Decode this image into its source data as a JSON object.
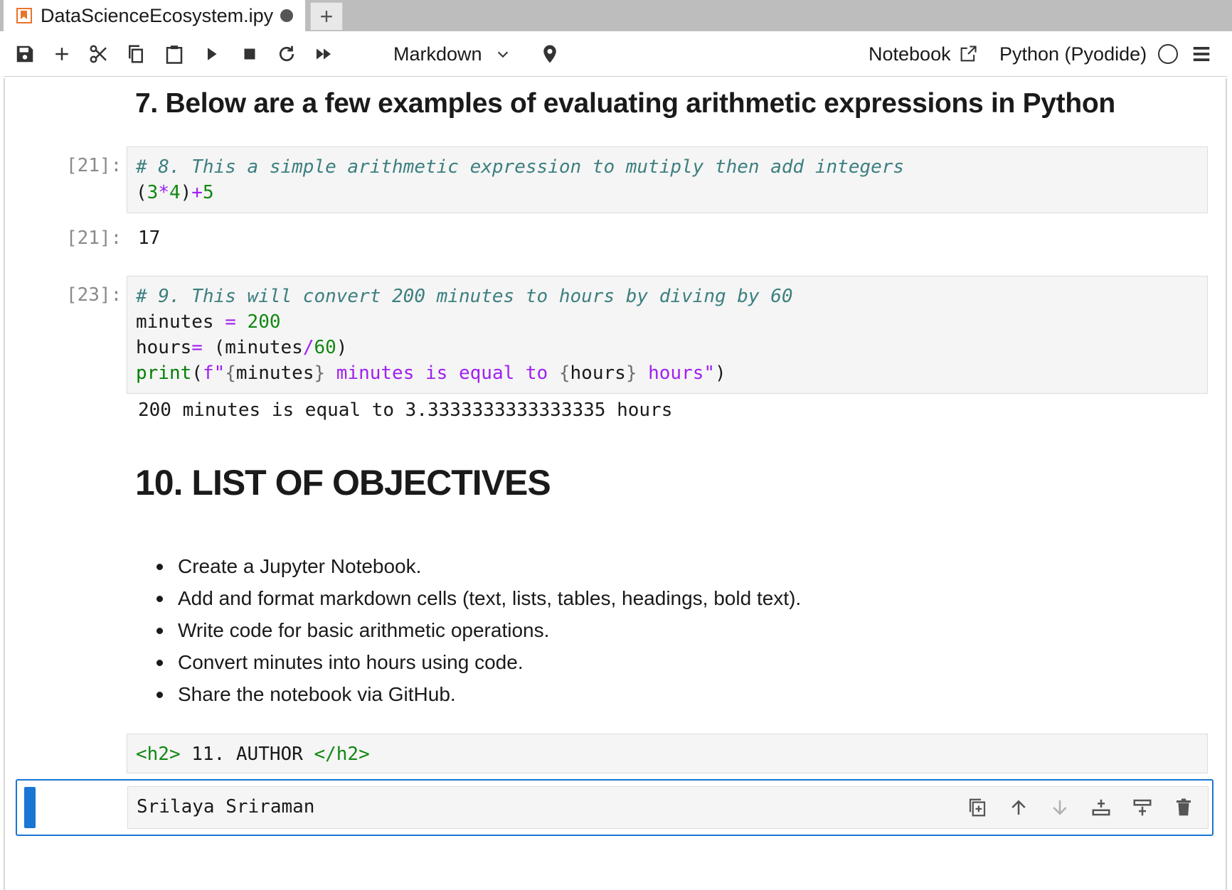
{
  "tab": {
    "title": "DataScienceEcosystem.ipy",
    "new_tab_label": "+"
  },
  "toolbar": {
    "icons": [
      "save-icon",
      "add-icon",
      "cut-icon",
      "copy-icon",
      "paste-icon",
      "run-icon",
      "stop-icon",
      "restart-icon",
      "fast-forward-icon",
      "pin-icon"
    ],
    "cell_type": "Markdown",
    "notebook_label": "Notebook",
    "kernel_label": "Python (Pyodide)"
  },
  "cells": {
    "heading7": "7. Below are a few examples of evaluating arithmetic expressions in Python",
    "cell21": {
      "prompt": "[21]:",
      "comment": "# 8. This a simple arithmetic expression to mutiply then add integers",
      "code": {
        "p1": "(",
        "n1": "3",
        "op1": "*",
        "n2": "4",
        "p2": ")",
        "op2": "+",
        "n3": "5"
      },
      "output_prompt": "[21]:",
      "output": "17"
    },
    "cell23": {
      "prompt": "[23]:",
      "comment": "# 9. This will convert 200 minutes to hours by diving by 60",
      "line2": {
        "name": "minutes ",
        "op": "=",
        "val": " 200"
      },
      "line3": {
        "name": "hours",
        "op": "=",
        "rest1": " (minutes",
        "div": "/",
        "val": "60",
        "rest2": ")"
      },
      "line4": {
        "fn": "print",
        "p1": "(",
        "fpref": "f\"",
        "b1": "{",
        "v1": "minutes",
        "b2": "}",
        "mid": " minutes is equal to ",
        "b3": "{",
        "v2": "hours",
        "b4": "}",
        "end": " hours\"",
        "p2": ")"
      },
      "output": "200 minutes is equal to 3.3333333333333335 hours"
    },
    "heading10": "10. LIST OF OBJECTIVES",
    "objectives": [
      "Create a Jupyter Notebook.",
      "Add and format markdown cells (text, lists, tables, headings, bold text).",
      "Write code for basic arithmetic operations.",
      "Convert minutes into hours using code.",
      "Share the notebook via GitHub."
    ],
    "raw": {
      "open": "<h2>",
      "text": " 11. AUTHOR ",
      "close": "</h2>"
    },
    "author": "Srilaya Sriraman"
  },
  "colors": {
    "accent": "#1976d2",
    "tab_icon": "#e8742c",
    "comment": "#3d7f7f",
    "number": "#118811",
    "operator": "#a020f0"
  }
}
